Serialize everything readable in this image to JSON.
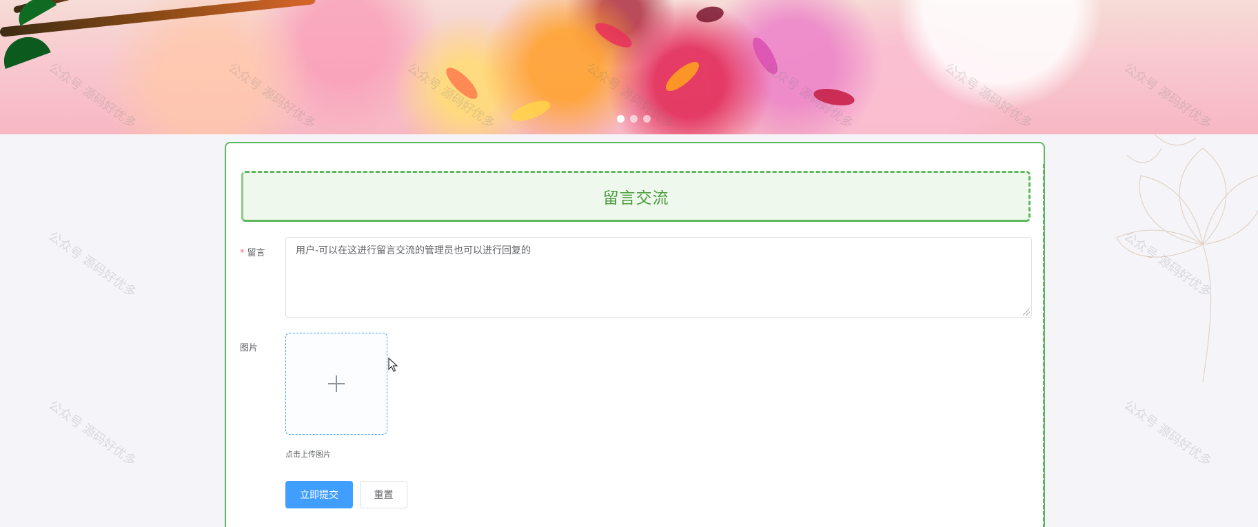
{
  "banner": {
    "carousel_dots": 3,
    "active_dot": 0
  },
  "form": {
    "title": "留言交流",
    "message_label": "留言",
    "required_mark": "*",
    "message_value": "用户-可以在这进行留言交流的管理员也可以进行回复的",
    "image_label": "图片",
    "upload_tip": "点击上传图片",
    "submit_label": "立即提交",
    "reset_label": "重置"
  },
  "watermark": {
    "text": "公众号 源码好优多"
  },
  "colors": {
    "accent_green": "#5cb85c",
    "primary_blue": "#409eff"
  }
}
